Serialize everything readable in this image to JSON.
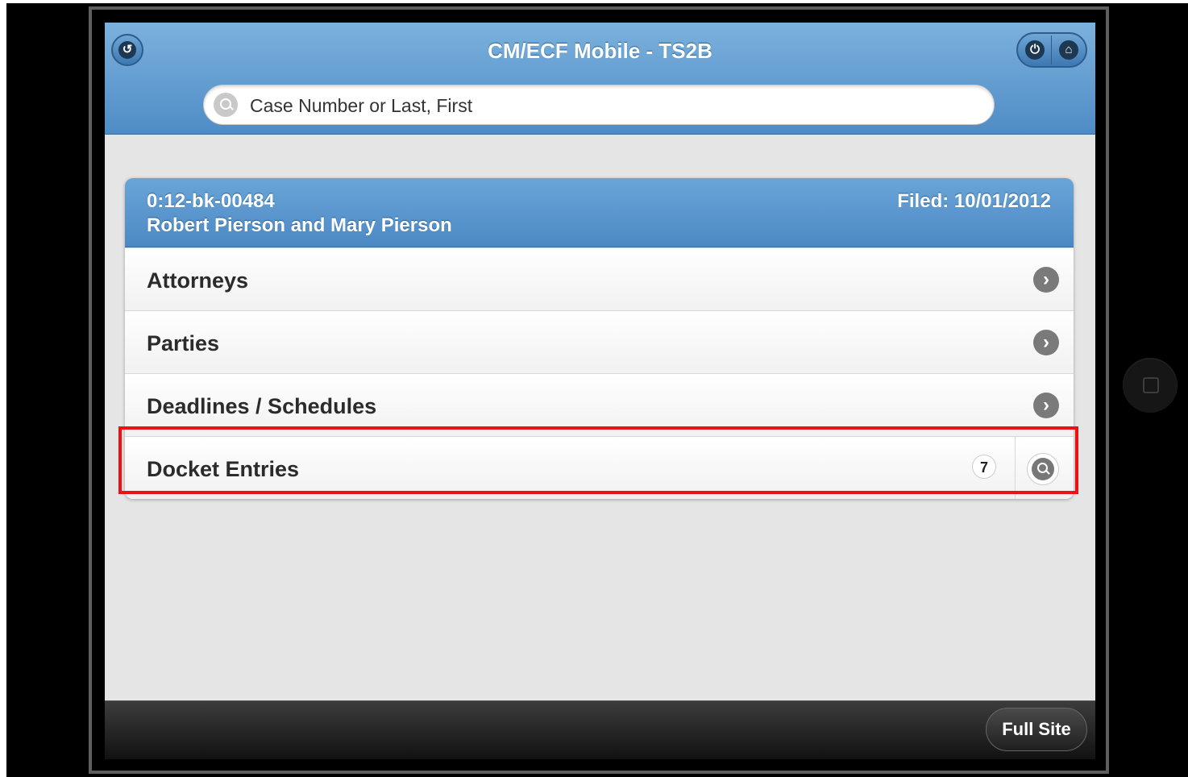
{
  "header": {
    "title": "CM/ECF Mobile - TS2B",
    "back_icon": "back-arrow-icon",
    "power_icon": "power-icon",
    "home_icon": "home-icon"
  },
  "search": {
    "placeholder": "Case Number or Last, First",
    "icon": "search-icon"
  },
  "case": {
    "number": "0:12-bk-00484",
    "name": "Robert Pierson and Mary Pierson",
    "filed": "Filed: 10/01/2012"
  },
  "menu": {
    "items": [
      {
        "label": "Attorneys",
        "icon": "chevron-right-icon"
      },
      {
        "label": "Parties",
        "icon": "chevron-right-icon"
      },
      {
        "label": "Deadlines / Schedules",
        "icon": "chevron-right-icon"
      },
      {
        "label": "Docket Entries",
        "count": "7",
        "icon": "search-icon"
      }
    ]
  },
  "footer": {
    "full_site_label": "Full Site"
  },
  "colors": {
    "header_blue": "#5b98cf",
    "highlight_red": "#ee1111",
    "footer_dark": "#222222"
  }
}
